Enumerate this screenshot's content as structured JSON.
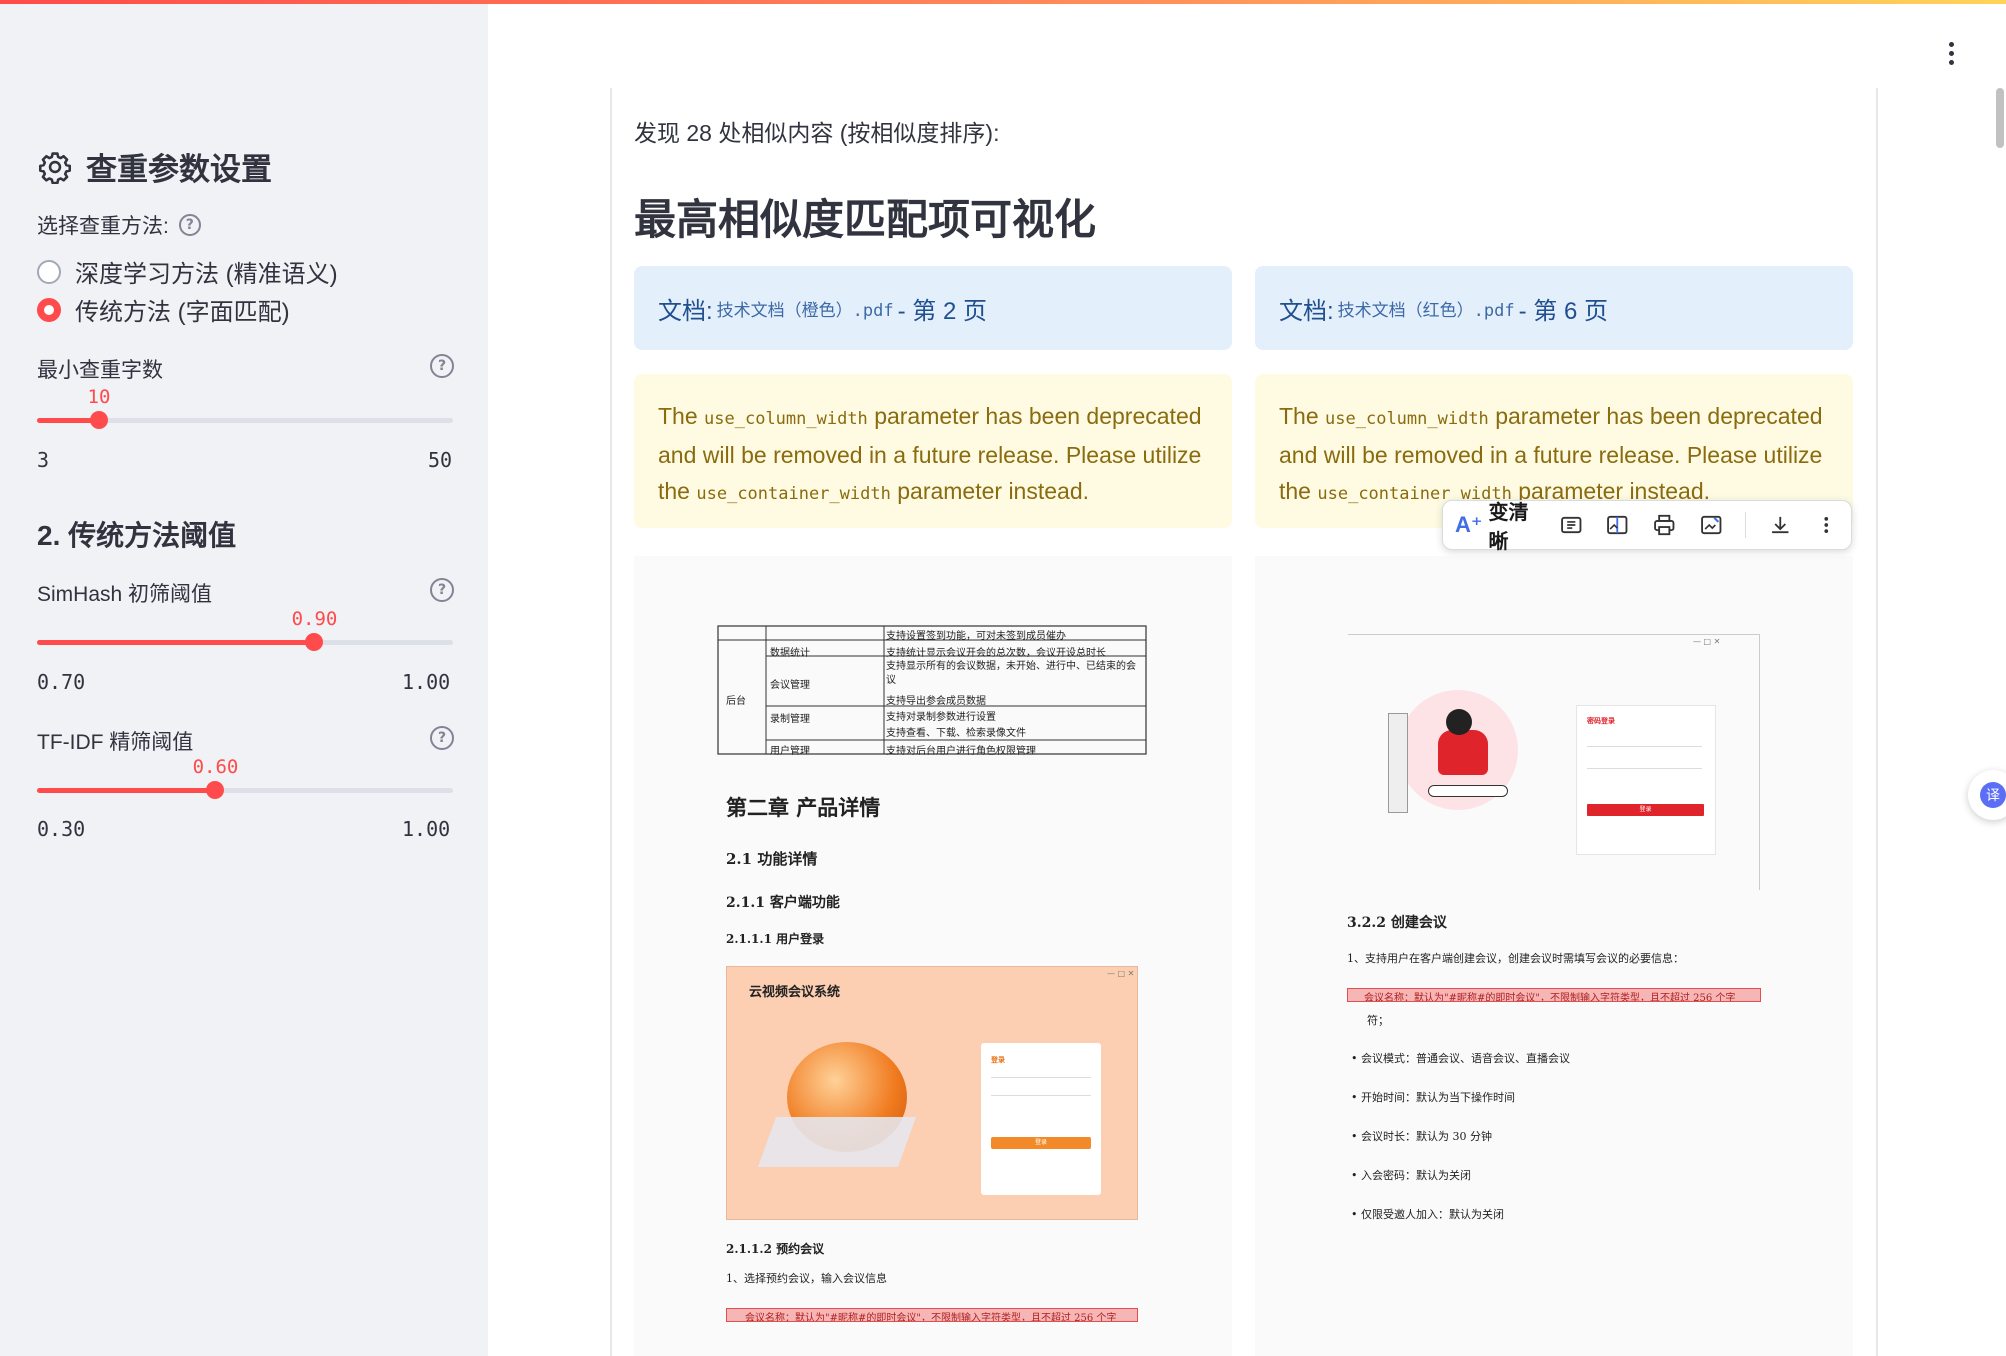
{
  "sidebar": {
    "title": "查重参数设置",
    "method_label": "选择查重方法:",
    "methods": [
      "深度学习方法 (精准语义)",
      "传统方法 (字面匹配)"
    ],
    "selected_method_index": 1,
    "min_chars": {
      "label": "最小查重字数",
      "value": "10",
      "min": "3",
      "max": "50",
      "fraction": 0.149
    },
    "section2_title": "2. 传统方法阈值",
    "simhash": {
      "label": "SimHash 初筛阈值",
      "value": "0.90",
      "min": "0.70",
      "max": "1.00",
      "fraction": 0.667
    },
    "tfidf": {
      "label": "TF-IDF 精筛阈值",
      "value": "0.60",
      "min": "0.30",
      "max": "1.00",
      "fraction": 0.429
    }
  },
  "main": {
    "found_text": "发现 28 处相似内容 (按相似度排序):",
    "heading": "最高相似度匹配项可视化",
    "left_doc": {
      "prefix": "文档:",
      "filename": "技术文档（橙色）.pdf",
      "page": "- 第 2 页"
    },
    "right_doc": {
      "prefix": "文档:",
      "filename": "技术文档（红色）.pdf",
      "page": "- 第 6 页"
    },
    "warning": {
      "p1": "The",
      "c1": "use_column_width",
      "p2": "parameter has been deprecated and will be removed in a future release. Please utilize the",
      "c2": "use_container_width",
      "p3": "parameter instead."
    }
  },
  "left_page": {
    "table_rows": [
      {
        "cat": "",
        "sub": "",
        "desc": "支持设置签到功能，可对未签到成员催办"
      },
      {
        "cat": "",
        "sub": "数据统计",
        "desc": "支持统计显示会议开会的总次数，会议开设总时长"
      },
      {
        "cat": "后台",
        "sub": "会议管理",
        "desc": "支持显示所有的会议数据，未开始、进行中、已结束的会议"
      },
      {
        "cat": "",
        "sub": "",
        "desc": "支持导出参会成员数据"
      },
      {
        "cat": "",
        "sub": "录制管理",
        "desc": "支持对录制参数进行设置"
      },
      {
        "cat": "",
        "sub": "",
        "desc": "支持查看、下载、检索录像文件"
      },
      {
        "cat": "",
        "sub": "用户管理",
        "desc": "支持对后台用户进行角色权限管理"
      }
    ],
    "chapter": "第二章 产品详情",
    "s21": "2.1  功能详情",
    "s211": "2.1.1  客户端功能",
    "s2111": "2.1.1.1  用户登录",
    "app_title": "云视频会议系统",
    "login_title": "登录",
    "login_btn": "登录",
    "s2112": "2.1.1.2  预约会议",
    "step1": "1、选择预约会议，输入会议信息",
    "highlight": "会议名称：默认为\"#昵称#的即时会议\"，不限制输入字符类型，且不超过 256 个字"
  },
  "right_page": {
    "login_title": "密码登录",
    "login_btn": "登录",
    "s322": "3.2.2  创建会议",
    "step1": "1、支持用户在客户端创建会议，创建会议时需填写会议的必要信息：",
    "highlight": "会议名称：默认为\"#昵称#的即时会议\"，不限制输入字符类型，且不超过 256 个字",
    "highlight_cont": "符；",
    "bullets": [
      "会议模式：普通会议、语音会议、直播会议",
      "开始时间：默认为当下操作时间",
      "会议时长：默认为 30 分钟",
      "入会密码：默认为关闭",
      "仅限受邀人加入：默认为关闭"
    ]
  },
  "toolbar": {
    "ai_icon": "A⁺",
    "ai_label": "变清晰"
  },
  "translate": {
    "label": "译"
  },
  "colors": {
    "accent": "#ff4b4b",
    "info_bg": "#e4effc",
    "warn_bg": "#fefbe2",
    "sidebar_bg": "#f0f2f6"
  }
}
